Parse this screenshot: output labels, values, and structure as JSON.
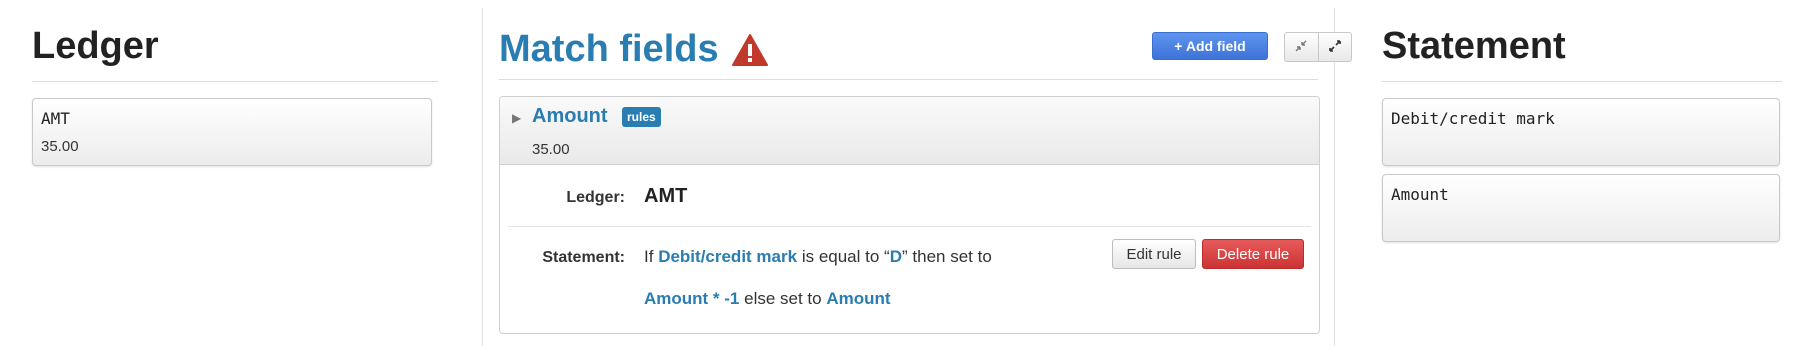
{
  "ledger": {
    "title": "Ledger",
    "fields": [
      {
        "name": "AMT",
        "value": "35.00"
      }
    ]
  },
  "match": {
    "title": "Match fields",
    "warning_icon": "warning-triangle-icon",
    "add_field_label": "+ Add field",
    "collapse_icon": "collapse-icon",
    "expand_icon": "expand-icon",
    "field": {
      "name": "Amount",
      "badge": "rules",
      "value": "35.00",
      "ledger_label": "Ledger:",
      "ledger_value": "AMT",
      "statement_label": "Statement:",
      "rule": {
        "if_word": "If",
        "condition_field": "Debit/credit mark",
        "operator": "is equal to",
        "open_quote": "“",
        "condition_value": "D",
        "close_quote": "”",
        "then_word": "then set to",
        "then_expr": "Amount * -1",
        "else_word": "else set to",
        "else_expr": "Amount"
      },
      "edit_rule_label": "Edit rule",
      "delete_rule_label": "Delete rule"
    }
  },
  "statement": {
    "title": "Statement",
    "fields": [
      {
        "name": "Debit/credit mark"
      },
      {
        "name": "Amount"
      }
    ]
  },
  "colors": {
    "accent": "#2a7db0",
    "primary_button": "#3d73d8",
    "danger_button": "#cc3333",
    "warning": "#c0392b"
  }
}
